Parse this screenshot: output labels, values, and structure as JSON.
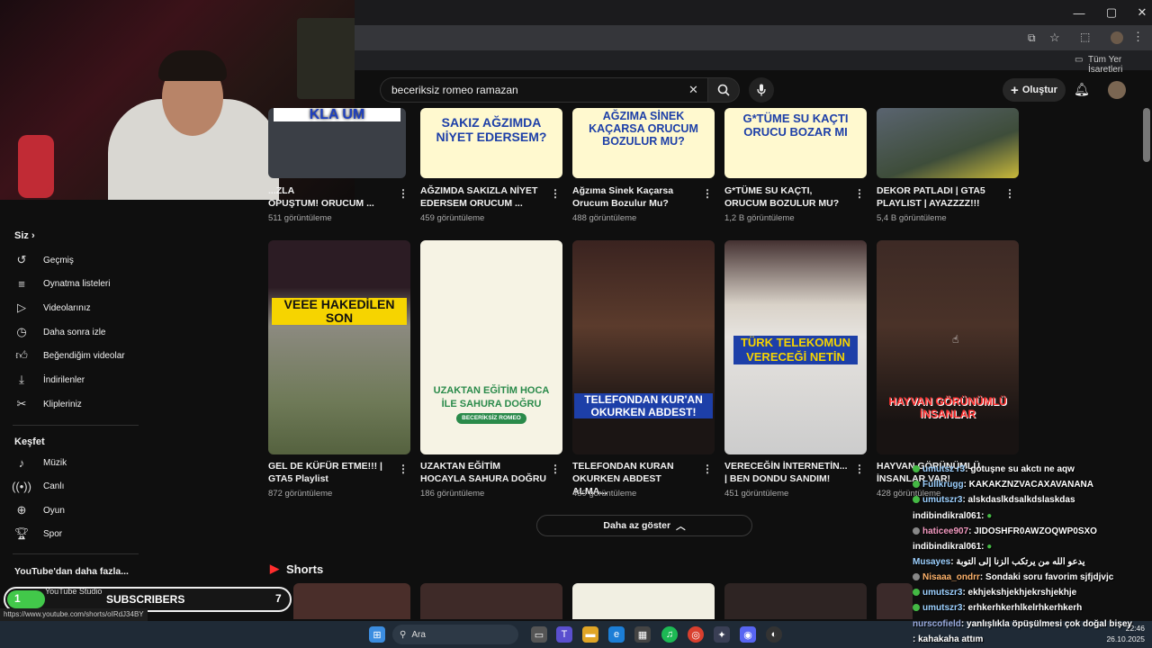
{
  "browser": {
    "bookmarks_label": "Tüm Yer İşaretleri",
    "status_url": "https://www.youtube.com/shorts/oIRdJ34BY",
    "window_controls": [
      "minimize-icon",
      "maximize-icon",
      "close-icon"
    ]
  },
  "header": {
    "search_value": "beceriksiz romeo ramazan",
    "create_label": "Oluştur"
  },
  "sidebar": {
    "you_label": "Siz",
    "you_items": [
      {
        "icon": "history-icon",
        "label": "Geçmiş"
      },
      {
        "icon": "playlist-icon",
        "label": "Oynatma listeleri"
      },
      {
        "icon": "video-icon",
        "label": "Videolarınız"
      },
      {
        "icon": "clock-icon",
        "label": "Daha sonra izle"
      },
      {
        "icon": "thumbs-up-icon",
        "label": "Beğendiğim videolar"
      },
      {
        "icon": "download-icon",
        "label": "İndirilenler"
      },
      {
        "icon": "scissors-icon",
        "label": "Klipleriniz"
      }
    ],
    "explore_label": "Keşfet",
    "explore_items": [
      {
        "icon": "music-icon",
        "label": "Müzik"
      },
      {
        "icon": "live-icon",
        "label": "Canlı"
      },
      {
        "icon": "gamepad-icon",
        "label": "Oyun"
      },
      {
        "icon": "trophy-icon",
        "label": "Spor"
      }
    ],
    "more_label": "YouTube'dan daha fazla...",
    "studio_label": "YouTube Studio"
  },
  "videos_row1": [
    {
      "thumb_text": "KLA ÜM",
      "title": "OPUŞTUM! ORUCUM ...",
      "title_line1": "...ZLA",
      "views": "511 görüntüleme"
    },
    {
      "thumb_text": "SAKIZ AĞZIMDA NİYET EDERSEM?",
      "title": "AĞZIMDA SAKIZLA NİYET EDERSEM ORUCUM ...",
      "views": "459 görüntüleme"
    },
    {
      "thumb_text": "AĞZIMA SİNEK KAÇARSA ORUCUM BOZULUR MU?",
      "title": "Ağzıma Sinek Kaçarsa Orucum Bozulur Mu?",
      "views": "488 görüntüleme"
    },
    {
      "thumb_text": "G*TÜME SU KAÇTI ORUCU BOZAR MI",
      "title": "G*TÜME SU KAÇTI, ORUCUM BOZULUR MU?",
      "views": "1,2 B görüntüleme"
    },
    {
      "thumb_text": "",
      "title": "DEKOR PATLADI | GTA5 PLAYLIST | AYAZZZZ!!!",
      "views": "5,4 B görüntüleme"
    }
  ],
  "videos_row2": [
    {
      "thumb_text": "VEEE HAKEDİLEN SON",
      "title": "GEL DE KÜFÜR ETME!!! | GTA5 Playlist",
      "views": "872 görüntüleme"
    },
    {
      "thumb_text": "UZAKTAN EĞİTİM HOCA İLE SAHURA DOĞRU",
      "thumb_badge": "BECERİKSİZ ROMEO",
      "title": "UZAKTAN EĞİTİM HOCAYLA SAHURA DOĞRU",
      "views": "186 görüntüleme"
    },
    {
      "thumb_text": "TELEFONDAN KUR'AN OKURKEN ABDEST!",
      "title": "TELEFONDAN KURAN OKURKEN ABDEST ALMA...",
      "views": "459 görüntüleme"
    },
    {
      "thumb_text": "TÜRK TELEKOMUN VERECEĞİ NETİN",
      "title": "VERECEĞİN İNTERNETİN... | BEN DONDU SANDIM!",
      "views": "451 görüntüleme"
    },
    {
      "thumb_text": "HAYVAN GÖRÜNÜMLÜ İNSANLAR",
      "title": "HAYVAN GÖRÜNÜMLÜ İNSANLAR VAR!",
      "views": "428 görüntüleme"
    }
  ],
  "show_less_label": "Daha az göster",
  "shorts_label": "Shorts",
  "chat": [
    {
      "user": "umutsz r3",
      "msg": ": gotuşne su akctı ne aqw"
    },
    {
      "user": "Fullkrugg",
      "msg": ": KAKAKZNZVACAXAVANANA"
    },
    {
      "user": "umutszr3",
      "msg": ": alskdaslkdsalkdslaskdas"
    },
    {
      "user": "indibindikral061",
      "msg": ":"
    },
    {
      "user": "haticee907",
      "msg": ": JIDOSHFR0AWZOQWP0SXO"
    },
    {
      "user": "indibindikral061",
      "msg": ":"
    },
    {
      "user": "Musayes",
      "msg": ": يدعو الله من يرتكب الزنا إلى التوبة"
    },
    {
      "user": "Nisaaa_ondrr",
      "msg": ": Sondaki soru favorim sjfjdjvjc"
    },
    {
      "user": "umutszr3",
      "msg": ": ekhjekshjekhjekrshjekhje"
    },
    {
      "user": "umutszr3",
      "msg": ": erhkerhkerhlkelrhkerhkerh"
    },
    {
      "user": "nurscofield",
      "msg": ": yanlışlıkla öpüşülmesi çok doğal bişey"
    },
    {
      "user": "",
      "msg": ": kahakaha attım"
    }
  ],
  "subscribers": {
    "left_number": "1",
    "label": "SUBSCRIBERS",
    "right_number": "7"
  },
  "taskbar": {
    "search_label": "Ara",
    "time": "22:46",
    "date": "26.10.2025"
  }
}
